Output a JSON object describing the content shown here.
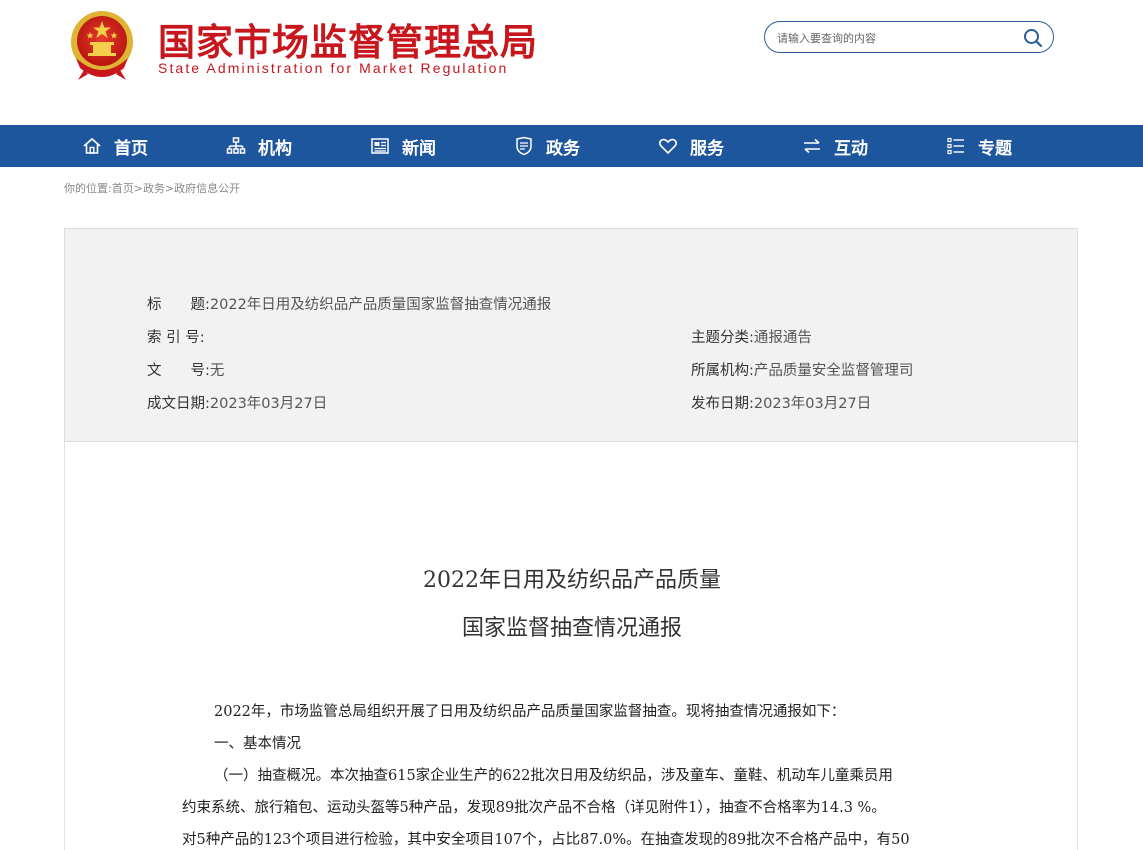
{
  "header": {
    "title_cn": "国家市场监督管理总局",
    "title_en": "State Administration for Market Regulation",
    "search_placeholder": "请输入要查询的内容"
  },
  "nav": {
    "items": [
      {
        "label": "首页",
        "icon": "home-icon"
      },
      {
        "label": "机构",
        "icon": "org-chart-icon"
      },
      {
        "label": "新闻",
        "icon": "newspaper-icon"
      },
      {
        "label": "政务",
        "icon": "shield-book-icon"
      },
      {
        "label": "服务",
        "icon": "heart-icon"
      },
      {
        "label": "互动",
        "icon": "exchange-arrows-icon"
      },
      {
        "label": "专题",
        "icon": "list-icon"
      }
    ]
  },
  "breadcrumb": {
    "prefix": "你的位置:",
    "items": [
      "首页",
      "政务",
      "政府信息公开"
    ],
    "separator": ">"
  },
  "meta": {
    "title_label": "标　　题:",
    "title_value": "2022年日用及纺织品产品质量国家监督抽查情况通报",
    "index_label": "索 引 号:",
    "index_value": "",
    "docno_label": "文　　号:",
    "docno_value": "无",
    "date_made_label": "成文日期:",
    "date_made_value": "2023年03月27日",
    "topic_label": "主题分类:",
    "topic_value": "通报通告",
    "org_label": "所属机构:",
    "org_value": "产品质量安全监督管理司",
    "date_pub_label": "发布日期:",
    "date_pub_value": "2023年03月27日"
  },
  "article": {
    "title_line1": "2022年日用及纺织品产品质量",
    "title_line2": "国家监督抽查情况通报",
    "paragraphs": [
      "2022年，市场监管总局组织开展了日用及纺织品产品质量国家监督抽查。现将抽查情况通报如下：",
      "一、基本情况",
      "（一）抽查概况。本次抽查615家企业生产的622批次日用及纺织品，涉及童车、童鞋、机动车儿童乘员用",
      "约束系统、旅行箱包、运动头盔等5种产品，发现89批次产品不合格（详见附件1），抽查不合格率为14.3 %。",
      "对5种产品的123个项目进行检验，其中安全项目107个，占比87.0%。在抽查发现的89批次不合格产品中，有50"
    ]
  },
  "colors": {
    "brand_red": "#c8161d",
    "nav_blue": "#1e569e"
  }
}
